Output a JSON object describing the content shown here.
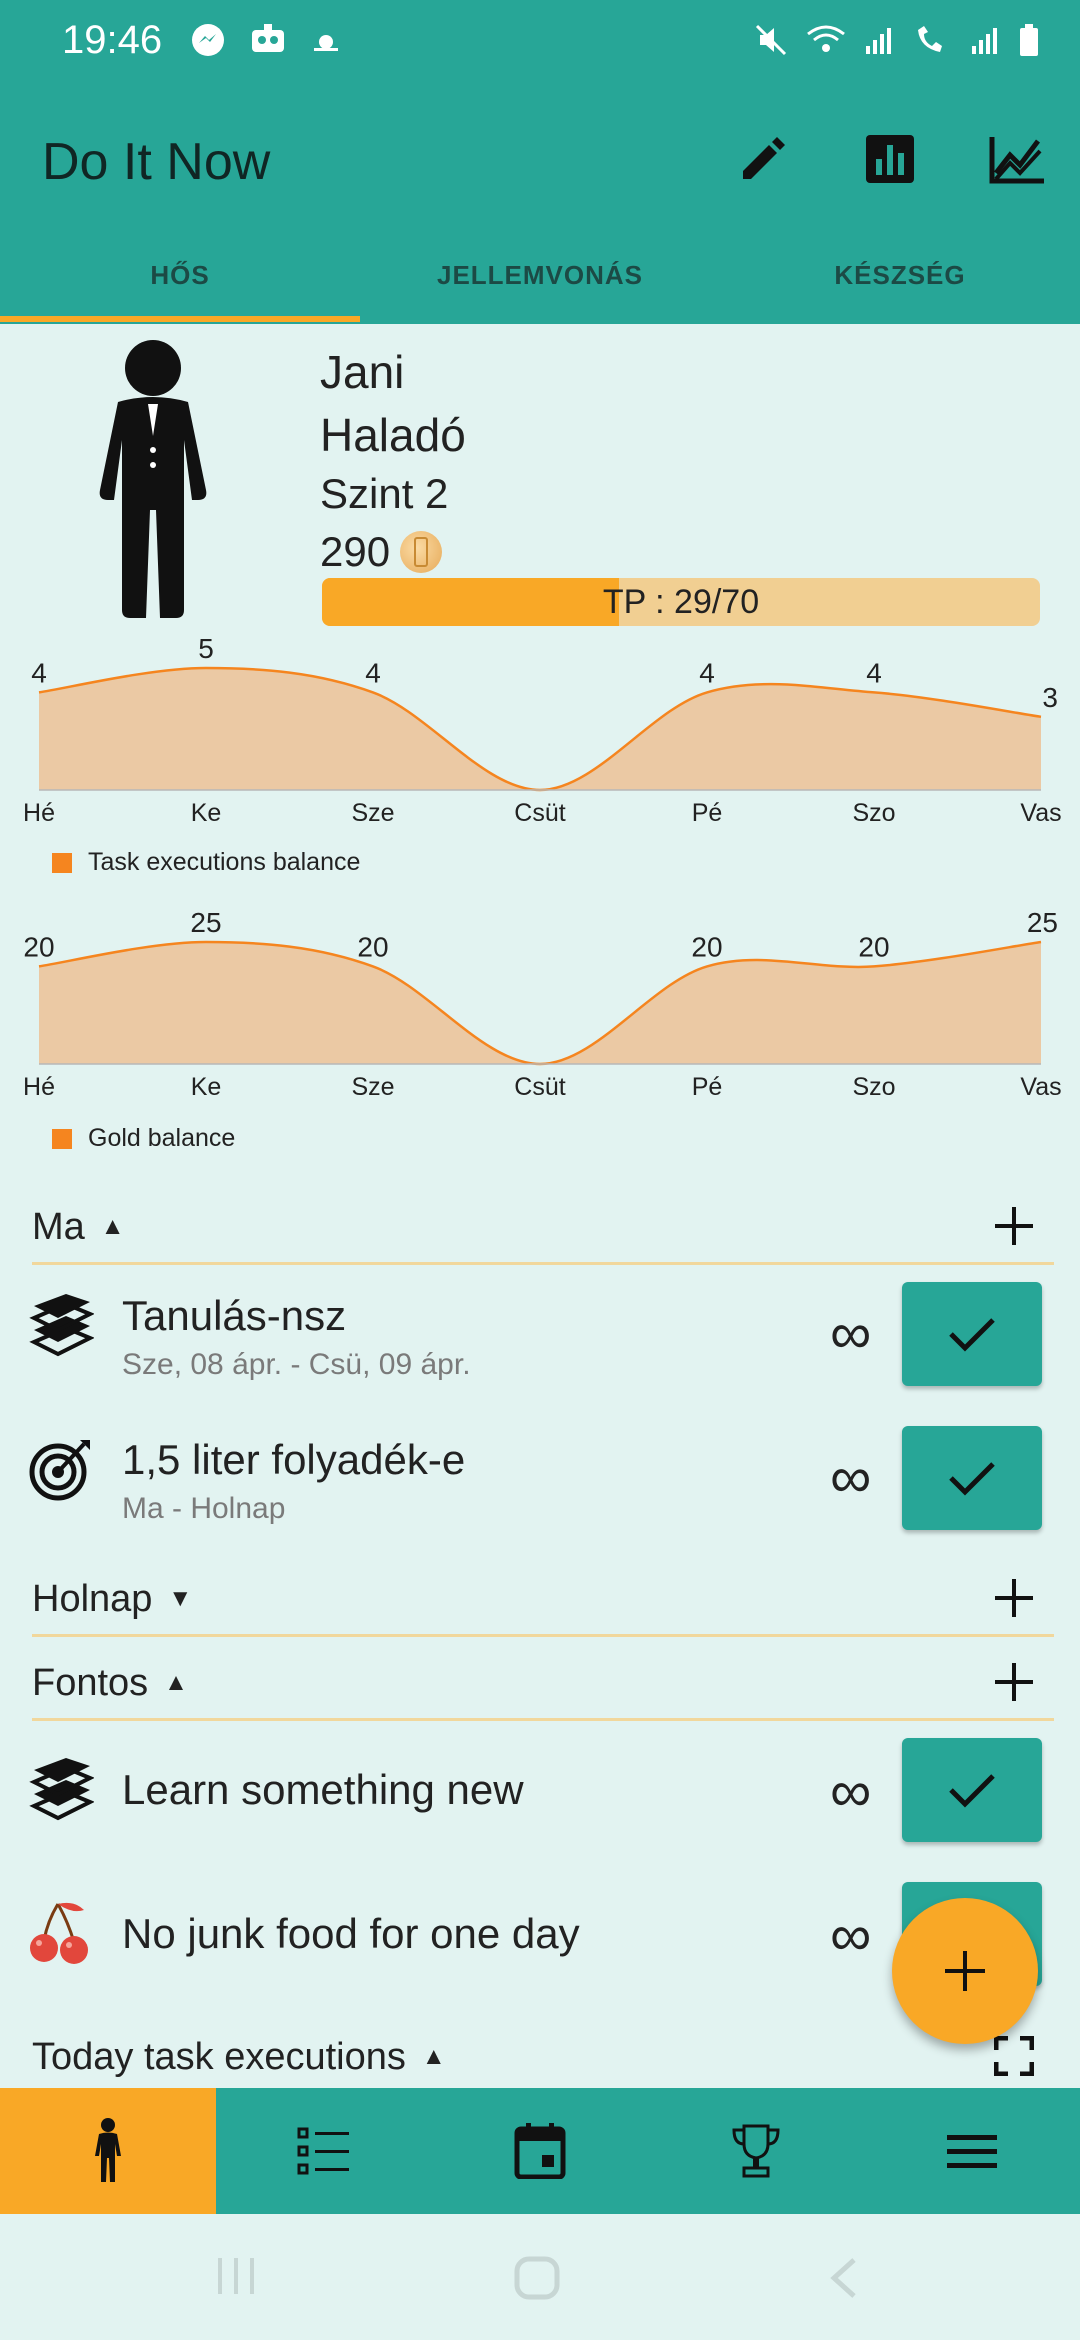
{
  "status_bar": {
    "time": "19:46"
  },
  "app": {
    "title": "Do It Now"
  },
  "toolbar": {
    "edit_icon": "pencil-icon",
    "stats_icon": "bar-chart-icon",
    "trend_icon": "line-chart-icon"
  },
  "tabs": [
    {
      "label": "HŐS",
      "active": true
    },
    {
      "label": "JELLEMVONÁS",
      "active": false
    },
    {
      "label": "KÉSZSÉG",
      "active": false
    }
  ],
  "hero": {
    "name": "Jani",
    "rank": "Haladó",
    "level": "Szint 2",
    "gold": "290",
    "xp_text": "TP : 29/70",
    "xp_fraction": 0.414
  },
  "chart_data": [
    {
      "type": "area",
      "categories": [
        "Hé",
        "Ke",
        "Sze",
        "Csüt",
        "Pé",
        "Szo",
        "Vas"
      ],
      "series": [
        {
          "name": "Task executions balance",
          "values": [
            4,
            5,
            4,
            0,
            4,
            4,
            3
          ]
        }
      ],
      "data_labels": [
        "4",
        "5",
        "4",
        "",
        "4",
        "4",
        "3"
      ],
      "ylim": [
        0,
        5
      ],
      "color": "#f5851f",
      "legend_position": "bottom-left"
    },
    {
      "type": "area",
      "categories": [
        "Hé",
        "Ke",
        "Sze",
        "Csüt",
        "Pé",
        "Szo",
        "Vas"
      ],
      "series": [
        {
          "name": "Gold balance",
          "values": [
            20,
            25,
            20,
            0,
            20,
            20,
            25
          ]
        }
      ],
      "data_labels": [
        "20",
        "25",
        "20",
        "",
        "20",
        "20",
        "25"
      ],
      "ylim": [
        0,
        25
      ],
      "color": "#f5851f",
      "legend_position": "bottom-left"
    }
  ],
  "sections": {
    "today": {
      "title": "Ma",
      "expanded": true
    },
    "tomorrow": {
      "title": "Holnap",
      "expanded": false
    },
    "important": {
      "title": "Fontos",
      "expanded": true
    },
    "executions": {
      "title": "Today task executions",
      "expanded": true
    }
  },
  "tasks": [
    {
      "title": "Tanulás-nsz",
      "subtitle": "Sze, 08 ápr. - Csü, 09 ápr.",
      "repeat": "∞",
      "icon": "books-icon"
    },
    {
      "title": "1,5 liter folyadék-e",
      "subtitle": "Ma - Holnap",
      "repeat": "∞",
      "icon": "target-icon"
    },
    {
      "title": "Learn something new",
      "subtitle": "",
      "repeat": "∞",
      "icon": "books-icon"
    },
    {
      "title": "No junk food for one day",
      "subtitle": "",
      "repeat": "∞",
      "icon": "cherry-icon"
    }
  ],
  "bottom_nav": [
    {
      "icon": "hero-icon",
      "active": true
    },
    {
      "icon": "task-list-icon",
      "active": false
    },
    {
      "icon": "calendar-icon",
      "active": false
    },
    {
      "icon": "trophy-icon",
      "active": false
    },
    {
      "icon": "menu-icon",
      "active": false
    }
  ],
  "colors": {
    "primary": "#27a697",
    "accent": "#f9a826",
    "background": "#e2f3f1",
    "chart_line": "#f5851f",
    "chart_fill": "#ebc9a4"
  }
}
